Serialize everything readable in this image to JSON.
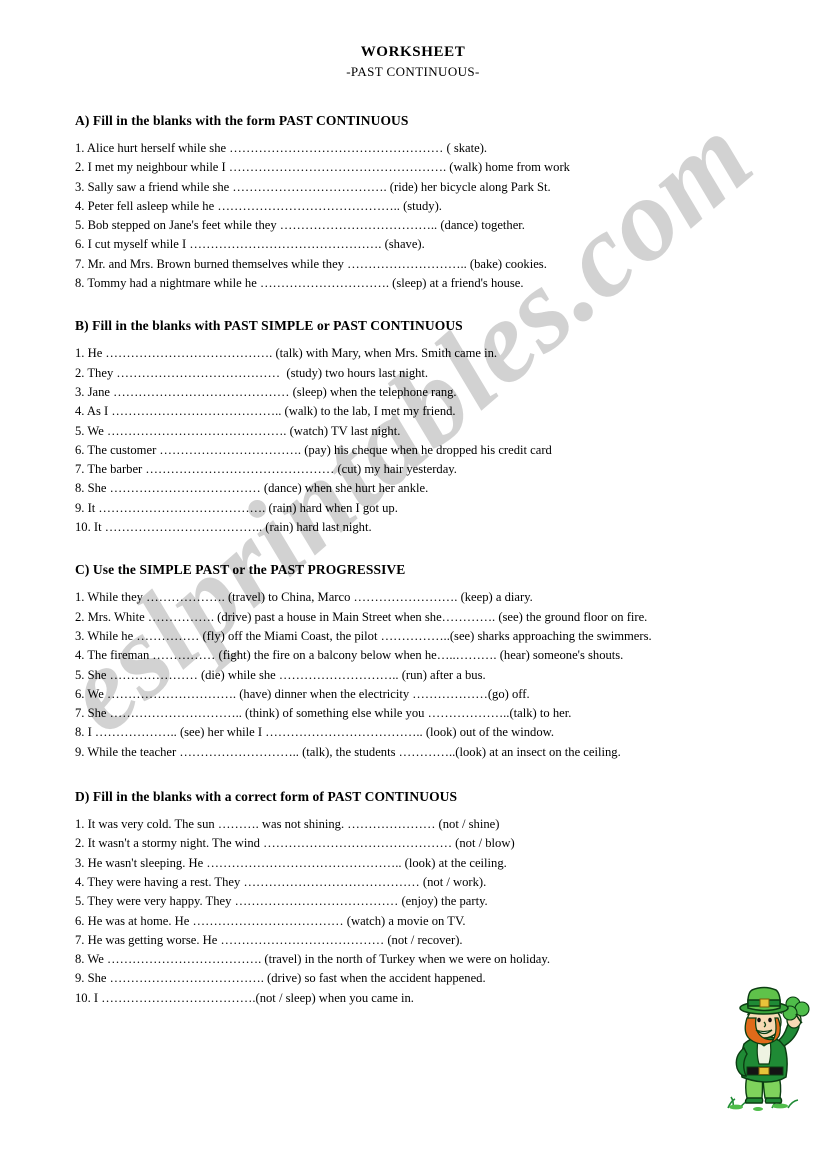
{
  "document": {
    "title": "WORKSHEET",
    "subtitle": "-PAST CONTINUOUS-"
  },
  "watermark": {
    "text": "eslprintables.com",
    "color": "#cfcfcf"
  },
  "clipart": {
    "name": "leprechaun-with-shamrock",
    "colors": {
      "suit_green": "#1f8a35",
      "light_green": "#5fc24a",
      "hat_green": "#3aa33c",
      "hair_orange": "#e06a1a",
      "skin": "#f6d9b4",
      "outline": "#0b3d12",
      "shamrock": "#4fbd4a",
      "belt_black": "#111111",
      "buckle_gold": "#e8c33a"
    }
  },
  "sections": [
    {
      "id": "A",
      "heading": "A) Fill in the blanks with the form PAST CONTINUOUS",
      "items": [
        "1. Alice hurt herself while she …………………………………………… ( skate).",
        "2. I met my neighbour while I ……………………………………………. (walk) home from work",
        "3. Sally saw a friend while she ………………………………. (ride) her bicycle along Park St.",
        "4. Peter fell asleep while he …………………………………….. (study).",
        "5. Bob stepped on Jane's feet while they ……………………………….. (dance) together.",
        "6. I cut myself while I ………………………………………. (shave).",
        "7. Mr. and Mrs. Brown burned themselves while they ……………………….. (bake) cookies.",
        "8. Tommy had a nightmare while he …………………………. (sleep) at a friend's house."
      ]
    },
    {
      "id": "B",
      "heading": "B) Fill in the blanks with  PAST SIMPLE or PAST CONTINUOUS",
      "items": [
        "1. He …………………………………. (talk) with Mary, when Mrs. Smith came in.",
        "2. They …………………………………  (study) two hours last night.",
        "3. Jane …………………………………… (sleep) when the telephone rang.",
        "4. As I ………………………………….. (walk) to the lab, I met my friend.",
        "5. We ……………………………………. (watch) TV last night.",
        "6. The customer ……………………………. (pay) his cheque when he dropped his credit card",
        "7. The barber ……………………………………… (cut) my hair yesterday.",
        "8. She ……………………………… (dance) when she hurt her ankle.",
        "9. It …………………………………. (rain) hard when I got up.",
        "10. It ……………………………….. (rain) hard last night."
      ]
    },
    {
      "id": "C",
      "heading": "C) Use the SIMPLE PAST or the PAST PROGRESSIVE",
      "items": [
        "1. While they ………………. (travel) to China, Marco ……………………. (keep) a diary.",
        "2. Mrs. White ……………. (drive) past a house in Main Street when she…………. (see) the ground floor on fire.",
        "3. While he …………… (fly) off the Miami Coast, the pilot ……………..(see) sharks approaching the swimmers.",
        "4. The fireman …………… (fight) the fire on a balcony below when he…..………. (hear) someone's shouts.",
        "5. She ………………… (die) while she ……………………….. (run) after a bus.",
        "6. We …………………………. (have) dinner when the electricity ………………(go) off.",
        "7. She ………………………….. (think) of something else while you ………………..(talk) to her.",
        "8. I ……………….. (see) her while I ……………………………….. (look) out of the window.",
        "9. While the teacher ……………………….. (talk), the students …………..(look) at an insect on the ceiling."
      ]
    },
    {
      "id": "D",
      "heading": "D) Fill in the blanks with a correct form of PAST CONTINUOUS",
      "items": [
        "1. It was very cold. The sun ………. was not shining. ………………… (not / shine)",
        "2. It wasn't a stormy night. The wind ……………………………………… (not / blow)",
        "3. He wasn't sleeping. He ……………………………………….. (look) at the ceiling.",
        "4. They were having a rest. They …………………………………… (not / work).",
        "5. They were very happy. They ………………………………… (enjoy) the party.",
        "6. He was at home. He ……………………………… (watch) a movie on TV.",
        "7. He was getting worse. He ………………………………… (not / recover).",
        "8. We ………………………………. (travel) in the north of Turkey when we were on holiday.",
        "9. She ………………………………. (drive) so fast when the accident happened.",
        "10. I ……………………………….(not / sleep) when you came in."
      ]
    }
  ]
}
